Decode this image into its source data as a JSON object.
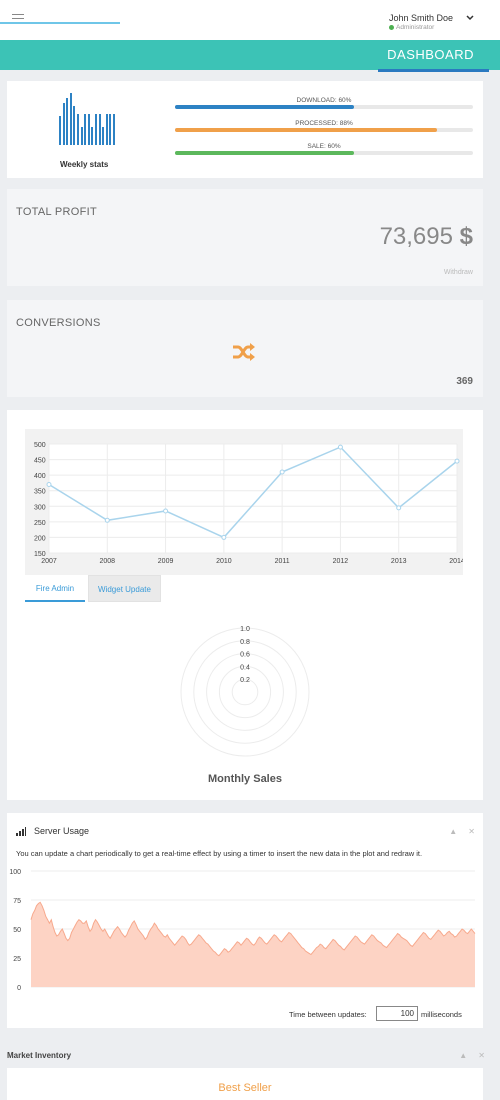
{
  "header": {
    "user_name": "John Smith Doe",
    "user_role": "Administrator",
    "page_title": "DASHBOARD",
    "online_color": "#4caf50",
    "icons": [
      "menu-icon",
      "chevron-down-icon"
    ]
  },
  "stats": {
    "weekly_label": "Weekly stats",
    "weekly_bars": [
      0.55,
      0.8,
      0.9,
      1.0,
      0.75,
      0.6,
      0.35,
      0.6,
      0.6,
      0.35,
      0.6,
      0.6,
      0.35,
      0.6,
      0.6,
      0.6
    ],
    "progress": [
      {
        "label": "DOWNLOAD: 60%",
        "value": 60,
        "color": "#2d82c4"
      },
      {
        "label": "PROCESSED: 88%",
        "value": 88,
        "color": "#f0a04a"
      },
      {
        "label": "SALE: 60%",
        "value": 60,
        "color": "#5cb85c"
      }
    ]
  },
  "profit": {
    "title": "TOTAL PROFIT",
    "value": "73,695",
    "currency": "$",
    "link": "Withdraw"
  },
  "conversions": {
    "title": "CONVERSIONS",
    "value": "369",
    "icon": "shuffle-icon",
    "icon_color": "#f0a04a"
  },
  "chart_data": [
    {
      "type": "line",
      "x": [
        2007,
        2008,
        2009,
        2010,
        2011,
        2012,
        2013,
        2014
      ],
      "values": [
        370,
        255,
        285,
        200,
        410,
        490,
        295,
        445
      ],
      "ylim": [
        150,
        500
      ],
      "yticks": [
        "500",
        "450",
        "400",
        "350",
        "300",
        "250",
        "200",
        "150"
      ],
      "xticks": [
        "2007",
        "2008",
        "2009",
        "2010",
        "2011",
        "2012",
        "2013",
        "2014"
      ],
      "grid": true,
      "color": "#a9d4ec"
    },
    {
      "type": "area",
      "title": "",
      "ylim": [
        0,
        100
      ],
      "yticks": [
        "100",
        "75",
        "50",
        "25",
        "0"
      ],
      "values": [
        58,
        63,
        66,
        70,
        72,
        73,
        70,
        66,
        61,
        58,
        55,
        58,
        52,
        47,
        44,
        45,
        48,
        50,
        46,
        42,
        40,
        42,
        47,
        50,
        53,
        56,
        58,
        57,
        55,
        55,
        57,
        52,
        48,
        50,
        55,
        58,
        56,
        53,
        50,
        48,
        50,
        47,
        44,
        42,
        45,
        48,
        50,
        52,
        50,
        47,
        45,
        43,
        45,
        49,
        52,
        55,
        57,
        54,
        50,
        48,
        46,
        44,
        41,
        43,
        47,
        50,
        52,
        55,
        53,
        50,
        48,
        46,
        44,
        43,
        45,
        42,
        40,
        38,
        36,
        38,
        40,
        42,
        44,
        43,
        41,
        38,
        36,
        37,
        39,
        41,
        43,
        45,
        44,
        42,
        40,
        38,
        37,
        35,
        33,
        31,
        30,
        28,
        27,
        29,
        31,
        33,
        32,
        30,
        31,
        33,
        35,
        37,
        39,
        38,
        36,
        38,
        40,
        42,
        41,
        39,
        37,
        36,
        38,
        41,
        43,
        42,
        40,
        38,
        37,
        39,
        41,
        43,
        45,
        44,
        42,
        40,
        39,
        41,
        43,
        45,
        47,
        46,
        44,
        42,
        40,
        38,
        36,
        34,
        33,
        31,
        30,
        29,
        28,
        30,
        32,
        34,
        35,
        37,
        36,
        34,
        33,
        35,
        37,
        39,
        41,
        40,
        38,
        36,
        35,
        33,
        32,
        34,
        36,
        38,
        40,
        42,
        44,
        43,
        41,
        39,
        38,
        37,
        39,
        41,
        43,
        45,
        44,
        42,
        40,
        39,
        38,
        36,
        35,
        34,
        36,
        38,
        40,
        42,
        44,
        46,
        45,
        43,
        42,
        41,
        40,
        38,
        36,
        35,
        37,
        39,
        41,
        43,
        45,
        47,
        46,
        44,
        42,
        41,
        43,
        45,
        47,
        49,
        48,
        46,
        44,
        45,
        47,
        48,
        46,
        45,
        43,
        44,
        46,
        48,
        50,
        49,
        47,
        46,
        48,
        50,
        48,
        46
      ]
    }
  ],
  "tabs": [
    {
      "label": "Fire Admin"
    },
    {
      "label": "Widget Update"
    }
  ],
  "polar": {
    "ticks": [
      "1.0",
      "0.8",
      "0.6",
      "0.4",
      "0.2"
    ],
    "label": "Monthly Sales"
  },
  "server_usage": {
    "title": "Server Usage",
    "description": "You can update a chart periodically to get a real-time effect by using a timer to insert the new data in the plot and redraw it.",
    "update_label": "Time between updates:",
    "update_value": "100",
    "update_unit": "milliseconds",
    "fill_color": "#fdd3c4",
    "line_color": "#f7a98d"
  },
  "market": {
    "title": "Market Inventory",
    "best_seller": "Best Seller"
  },
  "panel_controls": {
    "collapse": "▲",
    "close": "✕"
  }
}
